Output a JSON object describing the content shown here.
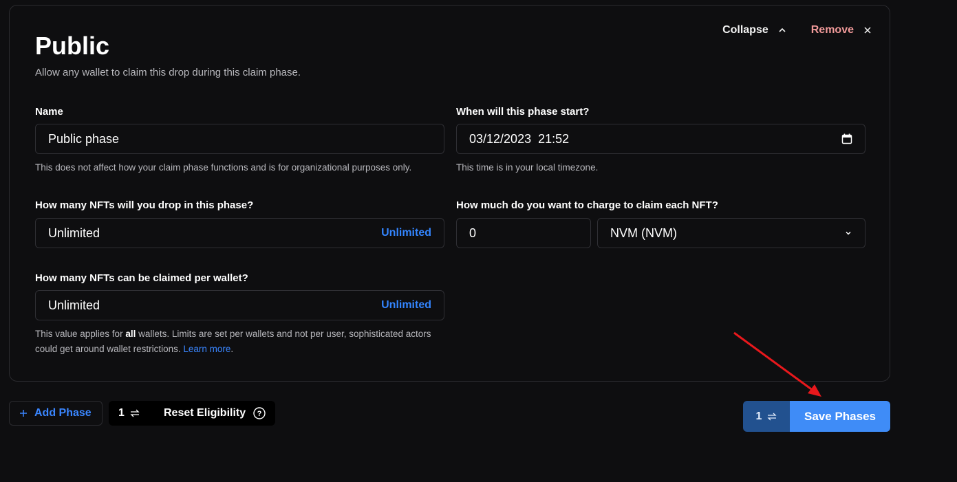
{
  "card": {
    "title": "Public",
    "subtitle": "Allow any wallet to claim this drop during this claim phase.",
    "collapse_label": "Collapse",
    "remove_label": "Remove"
  },
  "fields": {
    "name": {
      "label": "Name",
      "value": "Public phase",
      "help": "This does not affect how your claim phase functions and is for organizational purposes only."
    },
    "start": {
      "label": "When will this phase start?",
      "value": "03/12/2023  21:52",
      "help": "This time is in your local timezone."
    },
    "drop_count": {
      "label": "How many NFTs will you drop in this phase?",
      "value": "Unlimited",
      "link": "Unlimited"
    },
    "price": {
      "label": "How much do you want to charge to claim each NFT?",
      "amount": "0",
      "currency": "NVM (NVM)"
    },
    "per_wallet": {
      "label": "How many NFTs can be claimed per wallet?",
      "value": "Unlimited",
      "link": "Unlimited",
      "help_pre": "This value applies for ",
      "help_bold": "all",
      "help_mid": " wallets. Limits are set per wallets and not per user, sophisticated actors could get around wallet restrictions. ",
      "help_link": "Learn more",
      "help_end": "."
    }
  },
  "footer": {
    "add_phase_label": "Add Phase",
    "reset_count": "1",
    "reset_label": "Reset Eligibility",
    "save_count": "1",
    "save_label": "Save Phases"
  },
  "annotation": {
    "arrow_color": "#e8181c"
  }
}
